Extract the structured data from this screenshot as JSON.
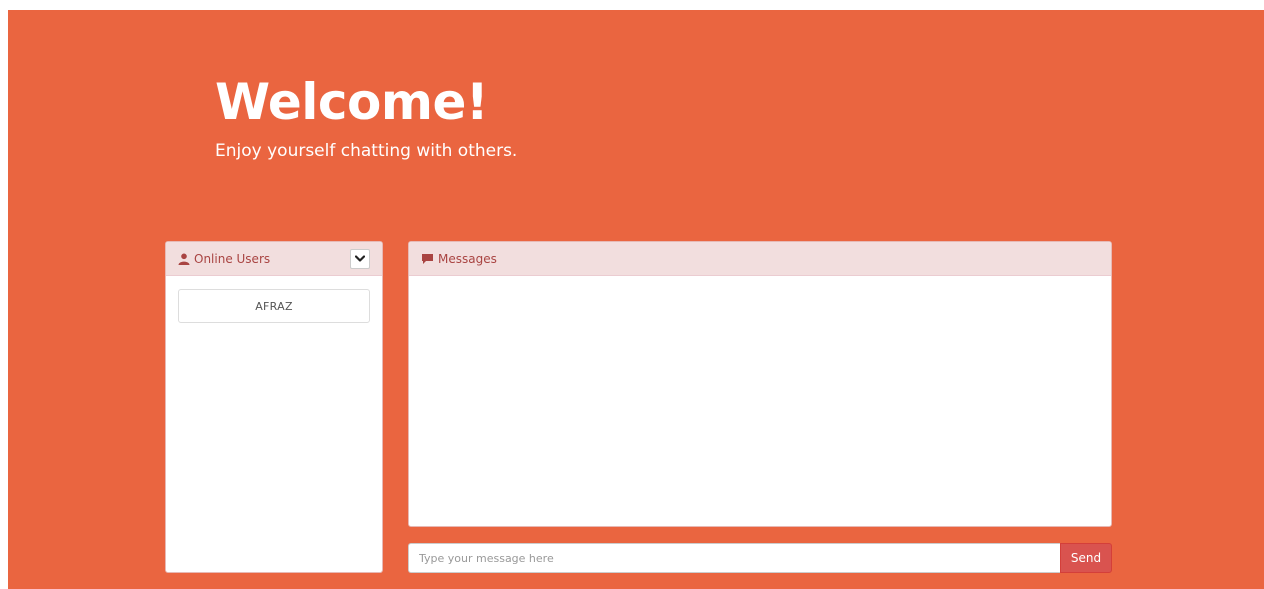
{
  "hero": {
    "title": "Welcome!",
    "subtitle": "Enjoy yourself chatting with others."
  },
  "users_panel": {
    "title": "Online Users",
    "icon": "user-icon",
    "toggle_icon": "chevron-down-icon",
    "users": [
      "AFRAZ"
    ]
  },
  "messages_panel": {
    "title": "Messages",
    "icon": "comment-icon",
    "messages": []
  },
  "composer": {
    "placeholder": "Type your message here",
    "value": "",
    "send_label": "Send"
  },
  "colors": {
    "background": "#ea6540",
    "panel_heading": "#f2dede",
    "panel_heading_text": "#a94442",
    "send_button": "#d9534f"
  }
}
